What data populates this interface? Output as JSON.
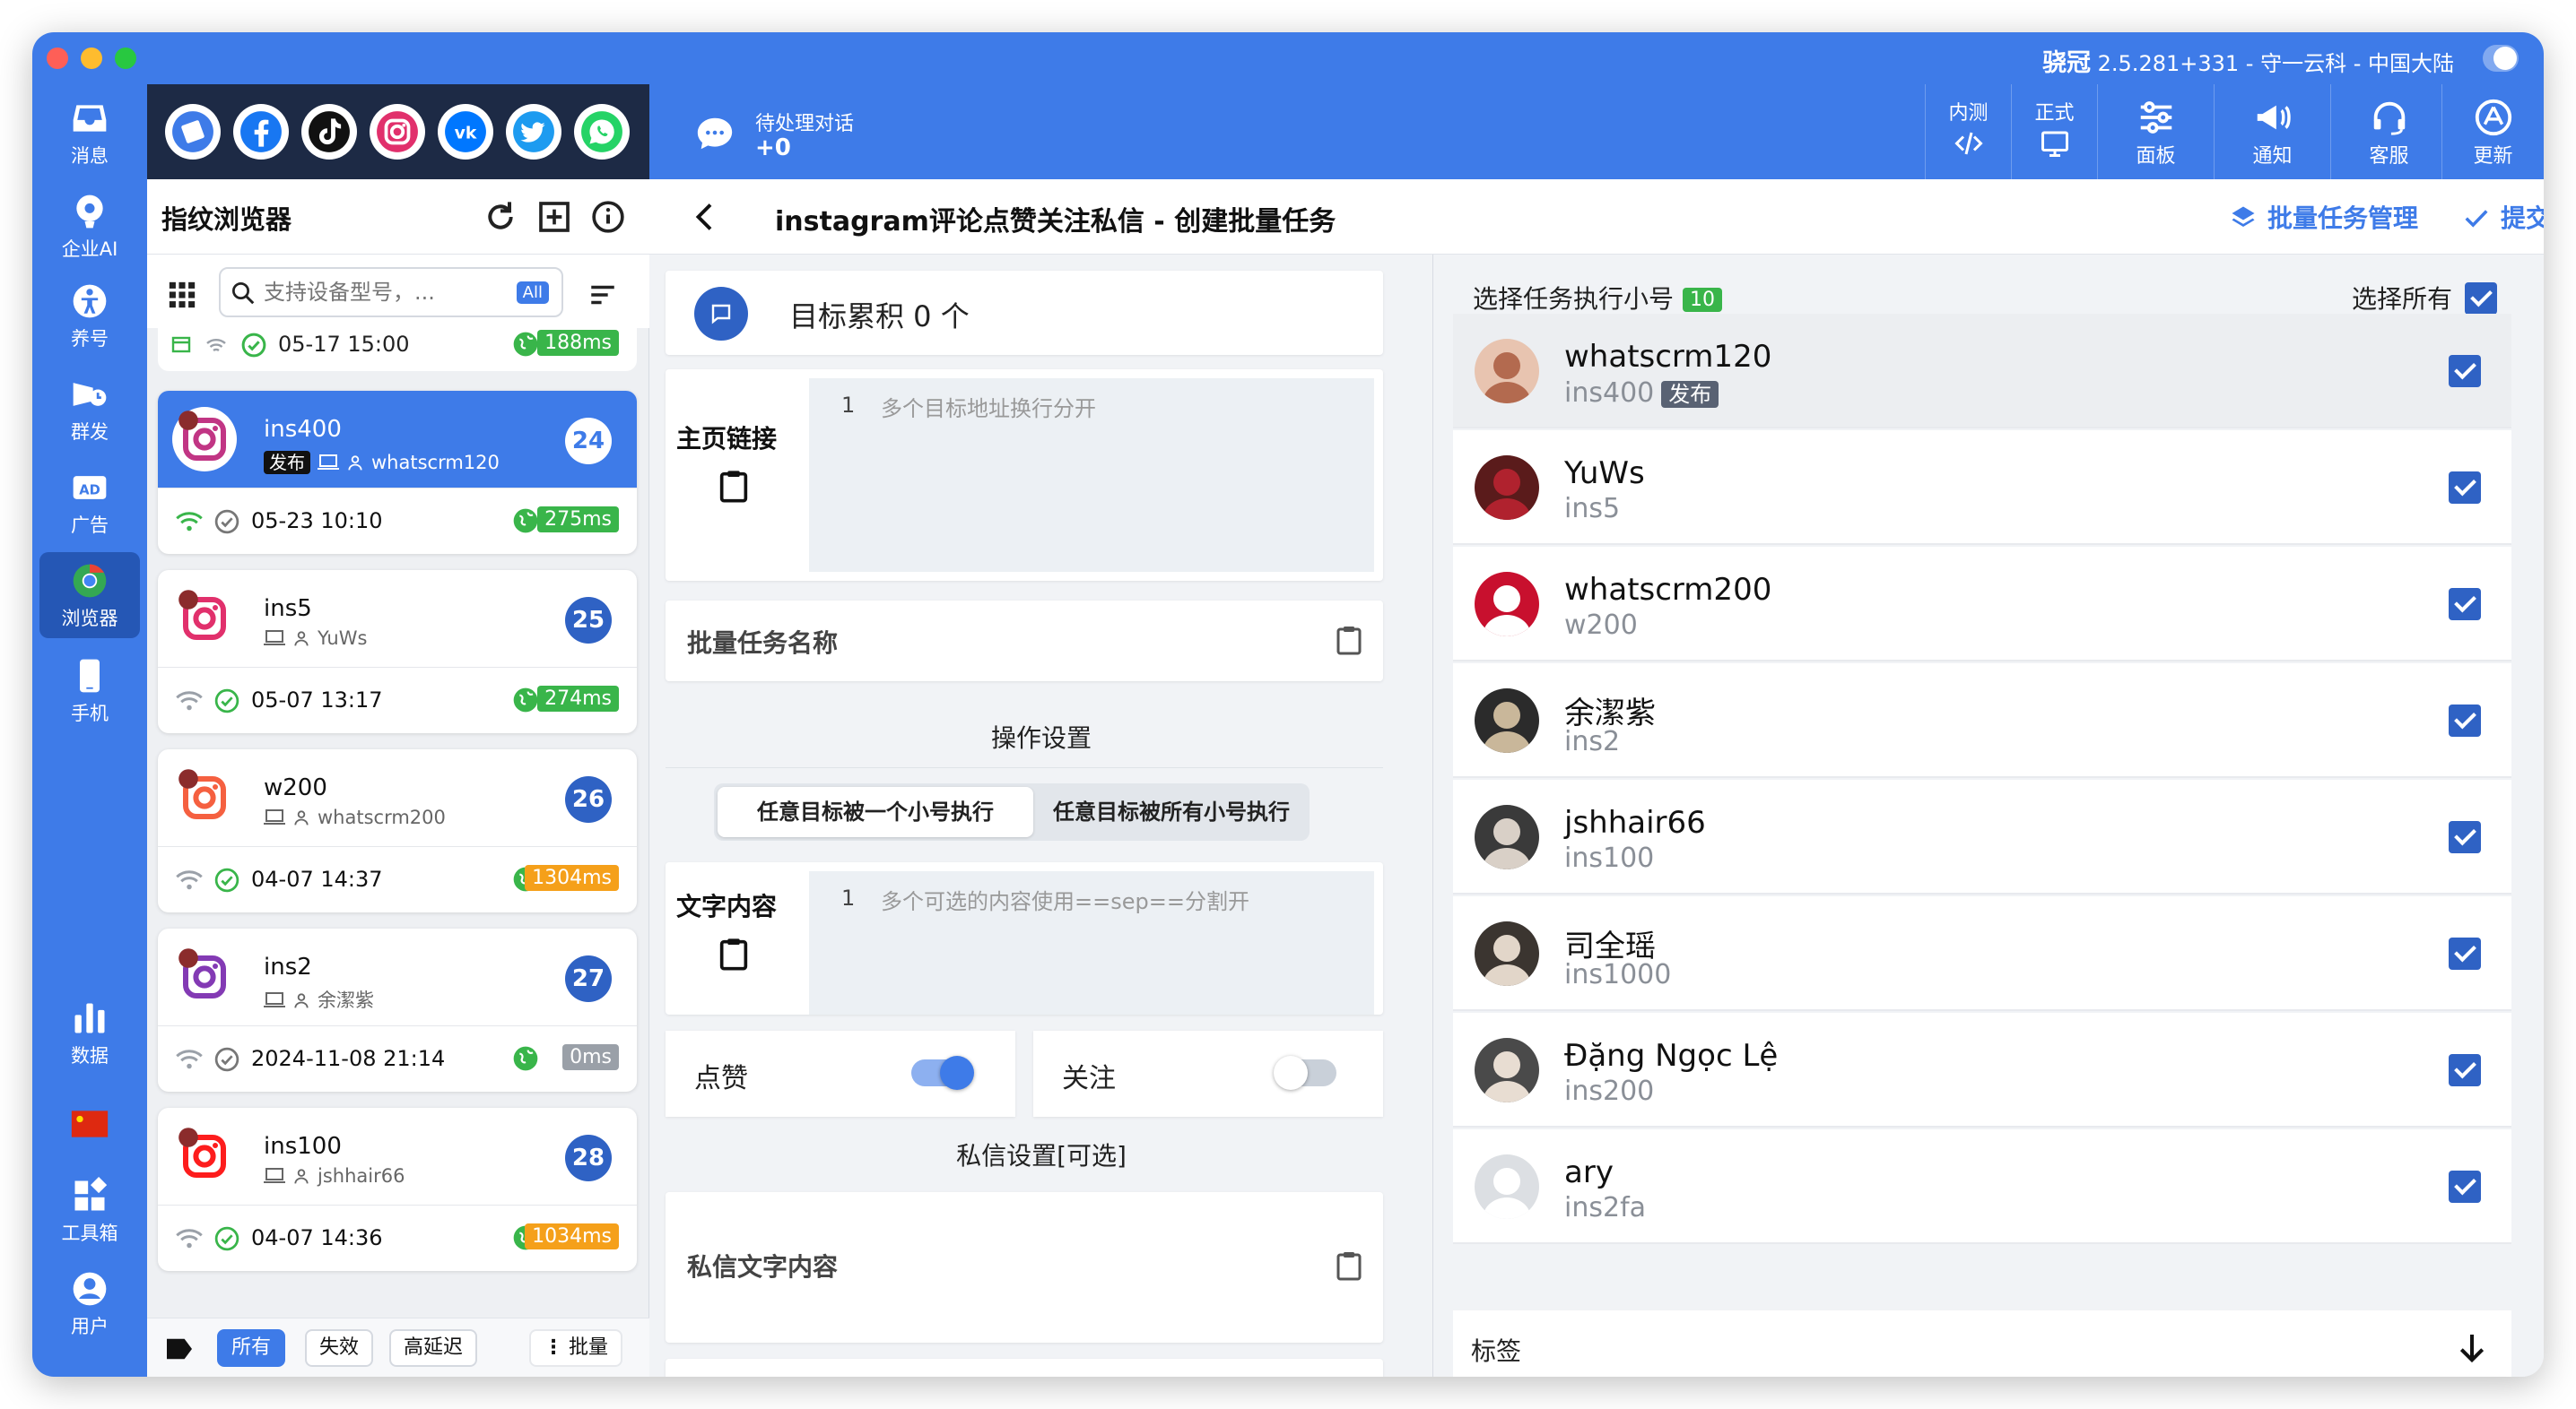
{
  "app": {
    "title_name": "骁冠",
    "title_rest": "2.5.281+331 - 守一云科 - 中国大陆"
  },
  "leftnav": [
    {
      "label": "消息",
      "icon": "inbox-icon"
    },
    {
      "label": "企业AI",
      "icon": "ai-icon"
    },
    {
      "label": "养号",
      "icon": "person-icon"
    },
    {
      "label": "群发",
      "icon": "broadcast-icon"
    },
    {
      "label": "广告",
      "icon": "ad-icon"
    },
    {
      "label": "浏览器",
      "icon": "chrome-icon",
      "active": true
    },
    {
      "label": "手机",
      "icon": "phone-icon"
    },
    {
      "label": "数据",
      "icon": "chart-icon"
    },
    {
      "label": "",
      "icon": "china-flag-icon"
    },
    {
      "label": "工具箱",
      "icon": "toolbox-icon"
    },
    {
      "label": "用户",
      "icon": "user-icon"
    }
  ],
  "topbar": {
    "pending_label": "待处理对话",
    "pending_count": "+0",
    "btn_beta": "内测",
    "btn_release": "正式",
    "btn_panel": "面板",
    "btn_notice": "通知",
    "btn_support": "客服",
    "btn_update": "更新"
  },
  "list": {
    "title": "指纹浏览器",
    "search_placeholder": "支持设备型号，...",
    "all_badge": "All",
    "partial_date": "05-17 15:00",
    "partial_ping": "188ms",
    "devices": [
      {
        "name": "ins400",
        "tag": "发布",
        "owner": "whatscrm120",
        "number": "24",
        "date": "05-23 10:10",
        "ping": "275ms",
        "status": "ok"
      },
      {
        "name": "ins5",
        "tag": "",
        "owner": "YuWs",
        "number": "25",
        "date": "05-07 13:17",
        "ping": "274ms",
        "status": "ok"
      },
      {
        "name": "w200",
        "tag": "",
        "owner": "whatscrm200",
        "number": "26",
        "date": "04-07 14:37",
        "ping": "1304ms",
        "status": "warn"
      },
      {
        "name": "ins2",
        "tag": "",
        "owner": "余潔紫",
        "number": "27",
        "date": "2024-11-08 21:14",
        "ping": "0ms",
        "status": "off"
      },
      {
        "name": "ins100",
        "tag": "",
        "owner": "jshhair66",
        "number": "28",
        "date": "04-07 14:36",
        "ping": "1034ms",
        "status": "warn"
      }
    ],
    "filters": {
      "all": "所有",
      "invalid": "失效",
      "high_latency": "高延迟",
      "batch": "批量"
    }
  },
  "content": {
    "page_title": "instagram评论点赞关注私信 - 创建批量任务",
    "batch_manage": "批量任务管理",
    "submit": "提交",
    "accum": "目标累积 0 个",
    "homepage_label": "主页链接",
    "line_no": "1",
    "homepage_placeholder": "多个目标地址换行分开",
    "batch_name_label": "批量任务名称",
    "op_settings": "操作设置",
    "mode_one": "任意目标被一个小号执行",
    "mode_all": "任意目标被所有小号执行",
    "text_label": "文字内容",
    "text_placeholder": "多个可选的内容使用==sep==分割开",
    "like_label": "点赞",
    "like_on": true,
    "follow_label": "关注",
    "follow_on": false,
    "dm_settings": "私信设置[可选]",
    "dm_text_label": "私信文字内容"
  },
  "accounts": {
    "header": "选择任务执行小号",
    "count": "10",
    "select_all": "选择所有",
    "tags_label": "标签",
    "items": [
      {
        "name": "whatscrm120",
        "sub": "ins400",
        "tag": "发布",
        "checked": true
      },
      {
        "name": "YuWs",
        "sub": "ins5",
        "tag": "",
        "checked": true
      },
      {
        "name": "whatscrm200",
        "sub": "w200",
        "tag": "",
        "checked": true
      },
      {
        "name": "余潔紫",
        "sub": "ins2",
        "tag": "",
        "checked": true
      },
      {
        "name": "jshhair66",
        "sub": "ins100",
        "tag": "",
        "checked": true
      },
      {
        "name": "司全瑶",
        "sub": "ins1000",
        "tag": "",
        "checked": true
      },
      {
        "name": "Đặng Ngọc Lệ",
        "sub": "ins200",
        "tag": "",
        "checked": true
      },
      {
        "name": "ary",
        "sub": "ins2fa",
        "tag": "",
        "checked": true
      }
    ]
  },
  "colors": {
    "primary": "#3e7be8",
    "dark_nav": "#1d2a45",
    "ok_green": "#39b54a",
    "warn_orange": "#f5a01a"
  }
}
